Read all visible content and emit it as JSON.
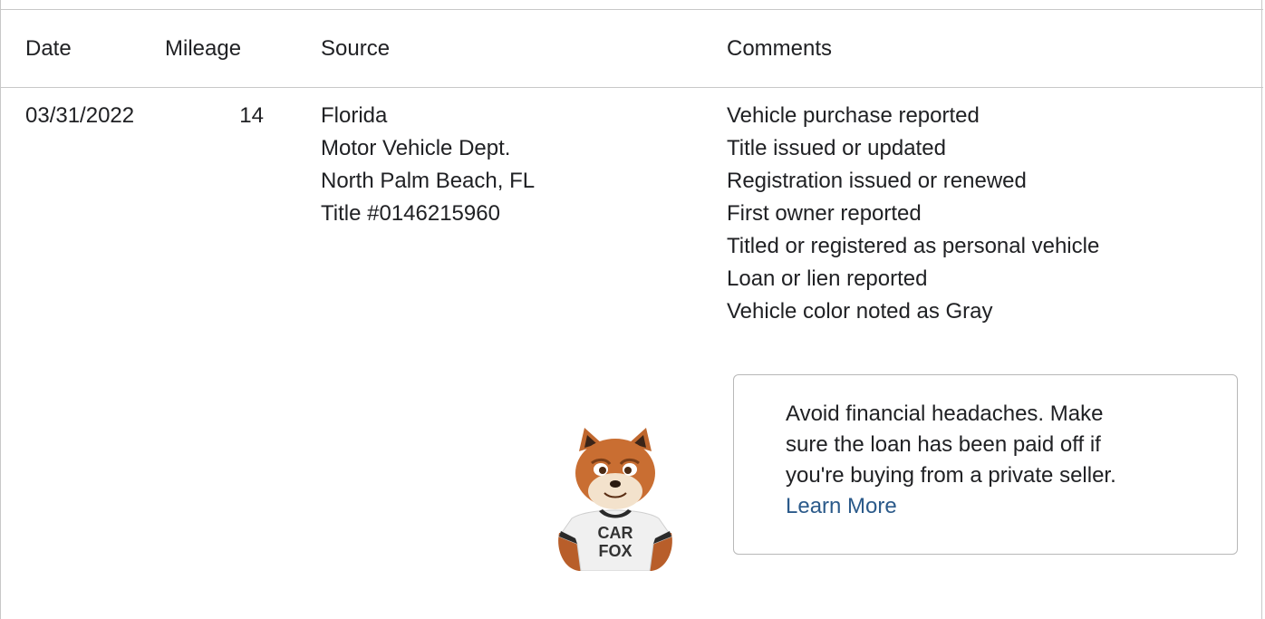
{
  "header": {
    "date": "Date",
    "mileage": "Mileage",
    "source": "Source",
    "comments": "Comments"
  },
  "record": {
    "date": "03/31/2022",
    "mileage": "14",
    "source": [
      "Florida",
      "Motor Vehicle Dept.",
      "North Palm Beach, FL",
      "Title #0146215960"
    ],
    "comments": [
      "Vehicle purchase reported",
      "Title issued or updated",
      "Registration issued or renewed",
      "First owner reported",
      "Titled or registered as personal vehicle",
      "Loan or lien reported",
      "Vehicle color noted as Gray"
    ]
  },
  "callout": {
    "lines": [
      "Avoid financial headaches. Make",
      "sure the loan has been paid off if",
      "you're buying from a private seller."
    ],
    "link_label": "Learn More",
    "link_color": "#2b5a8a"
  },
  "mascot": {
    "icon": "carfox-mascot-icon",
    "shirt_text": [
      "CAR",
      "FOX"
    ]
  }
}
